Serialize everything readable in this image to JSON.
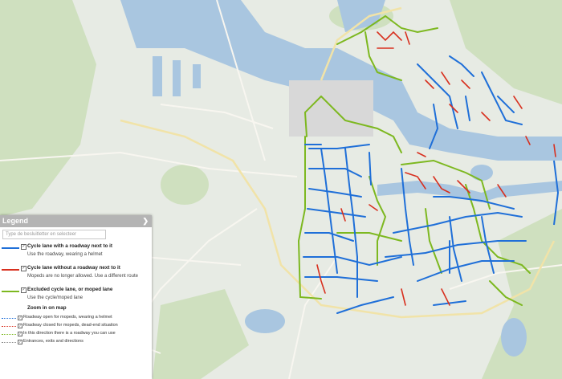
{
  "legend": {
    "title": "Legend",
    "toggle": "❯",
    "search_placeholder": "Type de besluitletter en selecteer",
    "items": [
      {
        "title": "Cycle lane with a roadway next to it",
        "desc": "Use the roadway, wearing a helmet",
        "color": "#1f6fd8"
      },
      {
        "title": "Cycle lane without a roadway next to it",
        "desc": "Mopeds are no longer allowed. Use a different route",
        "color": "#d8301f"
      },
      {
        "title": "Excluded cycle lane, or moped lane",
        "desc": "Use the cycle/moped lane",
        "color": "#7db820"
      }
    ],
    "zoom_title": "Zoom in on map",
    "sub_items": [
      {
        "text": "Roadway open for mopeds, wearing a helmet",
        "color": "#1f6fd8"
      },
      {
        "text": "Roadway closed for mopeds, dead-end situation",
        "color": "#d8301f"
      },
      {
        "text": "In this direction there is a roadway you can use",
        "color": "#7db820"
      },
      {
        "text": "Entrances, exits and directions",
        "color": "#888888"
      }
    ]
  },
  "colors": {
    "water": "#a9c6e0",
    "land": "#e7ebe4",
    "green": "#cfe0bf",
    "road": "#f5f3ee",
    "blue": "#1f6fd8",
    "red": "#d8301f",
    "lime": "#7db820"
  }
}
